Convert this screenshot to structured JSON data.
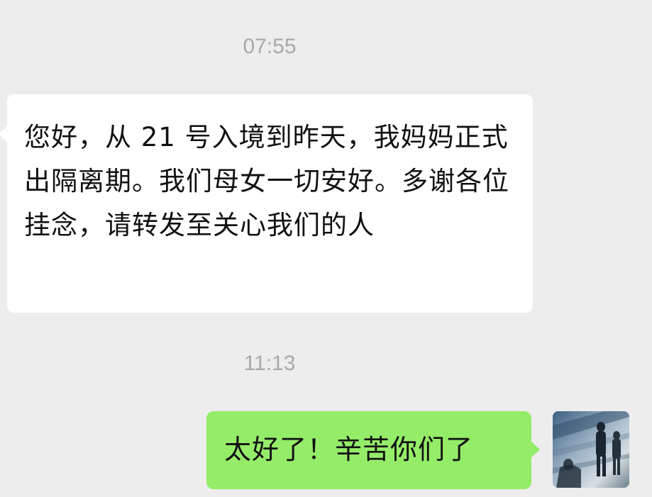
{
  "chat": {
    "timestamps": [
      "07:55",
      "11:13"
    ],
    "messages": [
      {
        "direction": "incoming",
        "text": "您好，从 21 号入境到昨天，我妈妈正式出隔离期。我们母女一切安好。多谢各位挂念，请转发至关心我们的人"
      },
      {
        "direction": "outgoing",
        "text": "太好了！辛苦你们了"
      }
    ]
  },
  "colors": {
    "background": "#ededed",
    "incoming_bubble": "#ffffff",
    "outgoing_bubble": "#95ec69",
    "timestamp_text": "#a9a9a9",
    "message_text": "#111111"
  },
  "icons": {
    "avatar": "user-avatar-photo"
  }
}
